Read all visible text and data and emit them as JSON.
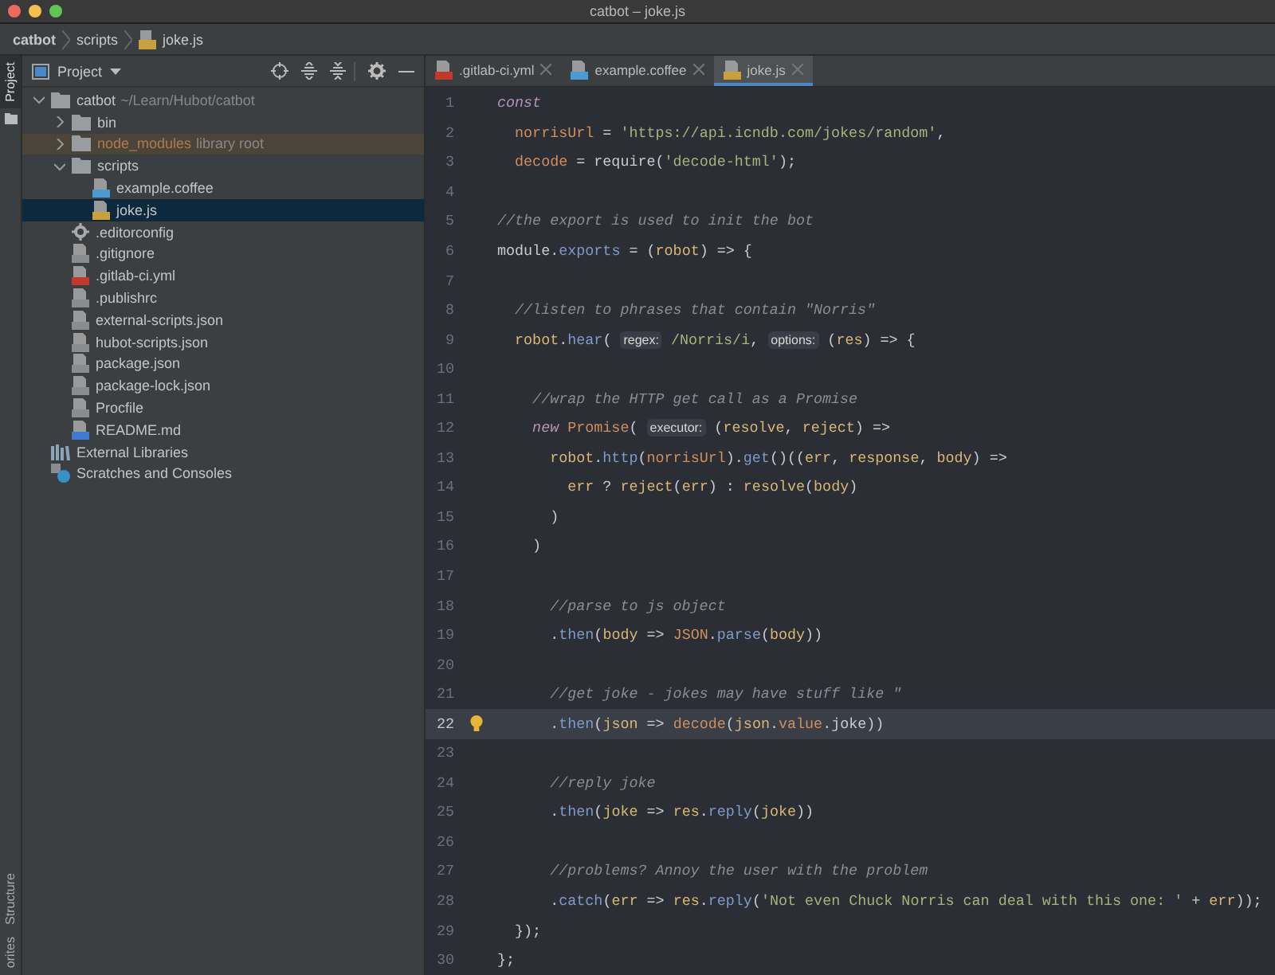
{
  "window": {
    "title": "catbot – joke.js"
  },
  "breadcrumb": [
    {
      "label": "catbot",
      "kind": "project"
    },
    {
      "label": "scripts",
      "kind": "folder"
    },
    {
      "label": "joke.js",
      "kind": "js"
    }
  ],
  "stripe": {
    "top": [
      {
        "label": "Project",
        "selected": true
      }
    ],
    "bottom": [
      {
        "label": "Structure",
        "selected": false
      },
      {
        "label": "orites",
        "selected": false
      }
    ]
  },
  "project_panel": {
    "title": "Project",
    "tree": [
      {
        "name": "catbot",
        "detail": "~/Learn/Hubot/catbot",
        "kind": "folder",
        "expanded": true,
        "selected": false,
        "children": [
          {
            "name": "bin",
            "kind": "folder",
            "expanded": false,
            "selected": false
          },
          {
            "name": "node_modules",
            "detail": "library root",
            "kind": "excluded",
            "expanded": false,
            "selected": false
          },
          {
            "name": "scripts",
            "kind": "folder",
            "expanded": true,
            "selected": false,
            "children": [
              {
                "name": "example.coffee",
                "kind": "coffee",
                "selected": false
              },
              {
                "name": "joke.js",
                "kind": "js",
                "selected": true
              }
            ]
          },
          {
            "name": ".editorconfig",
            "kind": "gear",
            "selected": false
          },
          {
            "name": ".gitignore",
            "kind": "ignore",
            "selected": false
          },
          {
            "name": ".gitlab-ci.yml",
            "kind": "yml",
            "selected": false
          },
          {
            "name": ".publishrc",
            "kind": "file",
            "selected": false
          },
          {
            "name": "external-scripts.json",
            "kind": "json",
            "selected": false
          },
          {
            "name": "hubot-scripts.json",
            "kind": "json",
            "selected": false
          },
          {
            "name": "package.json",
            "kind": "json",
            "selected": false
          },
          {
            "name": "package-lock.json",
            "kind": "json",
            "selected": false
          },
          {
            "name": "Procfile",
            "kind": "file",
            "selected": false
          },
          {
            "name": "README.md",
            "kind": "md",
            "selected": false
          }
        ]
      },
      {
        "name": "External Libraries",
        "kind": "libraries",
        "selected": false
      },
      {
        "name": "Scratches and Consoles",
        "kind": "scratches",
        "selected": false
      }
    ]
  },
  "tabs": [
    {
      "label": ".gitlab-ci.yml",
      "kind": "yml",
      "selected": false
    },
    {
      "label": "example.coffee",
      "kind": "coffee",
      "selected": false
    },
    {
      "label": "joke.js",
      "kind": "js",
      "selected": true
    }
  ],
  "code": [
    {
      "number": "1",
      "current": false,
      "tokens": [
        {
          "kind": "kw",
          "text": "const"
        }
      ]
    },
    {
      "number": "2",
      "current": false,
      "tokens": [
        {
          "kind": "local",
          "text": "  norrisUrl"
        },
        {
          "kind": "plain",
          "text": " = "
        },
        {
          "kind": "str",
          "text": "'https://api.icndb.com/jokes/random'"
        },
        {
          "kind": "plain",
          "text": ","
        }
      ]
    },
    {
      "number": "3",
      "current": false,
      "tokens": [
        {
          "kind": "local",
          "text": "  decode"
        },
        {
          "kind": "plain",
          "text": " = require("
        },
        {
          "kind": "str",
          "text": "'decode-html'"
        },
        {
          "kind": "plain",
          "text": ");"
        }
      ]
    },
    {
      "number": "4",
      "current": false
    },
    {
      "number": "5",
      "current": false,
      "tokens": [
        {
          "kind": "comment",
          "text": "//the export is used to init the bot"
        }
      ]
    },
    {
      "number": "6",
      "current": false,
      "tokens": [
        {
          "kind": "plain",
          "text": "module."
        },
        {
          "kind": "func",
          "text": "exports"
        },
        {
          "kind": "plain",
          "text": " = ("
        },
        {
          "kind": "param",
          "text": "robot"
        },
        {
          "kind": "plain",
          "text": ") => {"
        }
      ]
    },
    {
      "number": "7",
      "current": false
    },
    {
      "number": "8",
      "current": false,
      "tokens": [
        {
          "kind": "comment",
          "text": "  //listen to phrases that contain \"Norris\""
        }
      ]
    },
    {
      "number": "9",
      "current": false,
      "tokens": [
        {
          "kind": "param",
          "text": "  robot"
        },
        {
          "kind": "plain",
          "text": "."
        },
        {
          "kind": "func",
          "text": "hear"
        },
        {
          "kind": "plain",
          "text": "( "
        },
        {
          "kind": "hint",
          "text": "regex:"
        },
        {
          "kind": "str",
          "text": " /Norris/i"
        },
        {
          "kind": "plain",
          "text": ", "
        },
        {
          "kind": "hint",
          "text": "options:"
        },
        {
          "kind": "plain",
          "text": " ("
        },
        {
          "kind": "param",
          "text": "res"
        },
        {
          "kind": "plain",
          "text": ") => {"
        }
      ]
    },
    {
      "number": "10",
      "current": false
    },
    {
      "number": "11",
      "current": false,
      "tokens": [
        {
          "kind": "comment",
          "text": "    //wrap the HTTP get call as a Promise"
        }
      ]
    },
    {
      "number": "12",
      "current": false,
      "tokens": [
        {
          "kind": "kw",
          "text": "    new "
        },
        {
          "kind": "local",
          "text": "Promise"
        },
        {
          "kind": "plain",
          "text": "( "
        },
        {
          "kind": "hint",
          "text": "executor:"
        },
        {
          "kind": "plain",
          "text": " ("
        },
        {
          "kind": "param",
          "text": "resolve"
        },
        {
          "kind": "plain",
          "text": ", "
        },
        {
          "kind": "param",
          "text": "reject"
        },
        {
          "kind": "plain",
          "text": ") =>"
        }
      ]
    },
    {
      "number": "13",
      "current": false,
      "tokens": [
        {
          "kind": "param",
          "text": "      robot"
        },
        {
          "kind": "plain",
          "text": "."
        },
        {
          "kind": "func",
          "text": "http"
        },
        {
          "kind": "plain",
          "text": "("
        },
        {
          "kind": "local",
          "text": "norrisUrl"
        },
        {
          "kind": "plain",
          "text": ")."
        },
        {
          "kind": "func",
          "text": "get"
        },
        {
          "kind": "plain",
          "text": "()(("
        },
        {
          "kind": "param",
          "text": "err"
        },
        {
          "kind": "plain",
          "text": ", "
        },
        {
          "kind": "param",
          "text": "response"
        },
        {
          "kind": "plain",
          "text": ", "
        },
        {
          "kind": "param",
          "text": "body"
        },
        {
          "kind": "plain",
          "text": ") =>"
        }
      ]
    },
    {
      "number": "14",
      "current": false,
      "tokens": [
        {
          "kind": "param",
          "text": "        err"
        },
        {
          "kind": "plain",
          "text": " ? "
        },
        {
          "kind": "param",
          "text": "reject"
        },
        {
          "kind": "plain",
          "text": "("
        },
        {
          "kind": "param",
          "text": "err"
        },
        {
          "kind": "plain",
          "text": ") : "
        },
        {
          "kind": "param",
          "text": "resolve"
        },
        {
          "kind": "plain",
          "text": "("
        },
        {
          "kind": "param",
          "text": "body"
        },
        {
          "kind": "plain",
          "text": ")"
        }
      ]
    },
    {
      "number": "15",
      "current": false,
      "tokens": [
        {
          "kind": "plain",
          "text": "      )"
        }
      ]
    },
    {
      "number": "16",
      "current": false,
      "tokens": [
        {
          "kind": "plain",
          "text": "    )"
        }
      ]
    },
    {
      "number": "17",
      "current": false
    },
    {
      "number": "18",
      "current": false,
      "tokens": [
        {
          "kind": "comment",
          "text": "      //parse to js object"
        }
      ]
    },
    {
      "number": "19",
      "current": false,
      "tokens": [
        {
          "kind": "plain",
          "text": "      ."
        },
        {
          "kind": "func",
          "text": "then"
        },
        {
          "kind": "plain",
          "text": "("
        },
        {
          "kind": "param",
          "text": "body"
        },
        {
          "kind": "plain",
          "text": " => "
        },
        {
          "kind": "local",
          "text": "JSON"
        },
        {
          "kind": "plain",
          "text": "."
        },
        {
          "kind": "func",
          "text": "parse"
        },
        {
          "kind": "plain",
          "text": "("
        },
        {
          "kind": "param",
          "text": "body"
        },
        {
          "kind": "plain",
          "text": "))"
        }
      ]
    },
    {
      "number": "20",
      "current": false
    },
    {
      "number": "21",
      "current": false,
      "tokens": [
        {
          "kind": "comment",
          "text": "      //get joke - jokes may have stuff like \""
        }
      ]
    },
    {
      "number": "22",
      "current": true,
      "tokens": [
        {
          "kind": "plain",
          "text": "      ."
        },
        {
          "kind": "func",
          "text": "then"
        },
        {
          "kind": "plain",
          "text": "("
        },
        {
          "kind": "param",
          "text": "json"
        },
        {
          "kind": "plain",
          "text": " => "
        },
        {
          "kind": "local",
          "text": "decode"
        },
        {
          "kind": "plain",
          "text": "("
        },
        {
          "kind": "param",
          "text": "json"
        },
        {
          "kind": "plain",
          "text": "."
        },
        {
          "kind": "local",
          "text": "value"
        },
        {
          "kind": "plain",
          "text": ".joke))"
        }
      ]
    },
    {
      "number": "23",
      "current": false
    },
    {
      "number": "24",
      "current": false,
      "tokens": [
        {
          "kind": "comment",
          "text": "      //reply joke"
        }
      ]
    },
    {
      "number": "25",
      "current": false,
      "tokens": [
        {
          "kind": "plain",
          "text": "      ."
        },
        {
          "kind": "func",
          "text": "then"
        },
        {
          "kind": "plain",
          "text": "("
        },
        {
          "kind": "param",
          "text": "joke"
        },
        {
          "kind": "plain",
          "text": " => "
        },
        {
          "kind": "param",
          "text": "res"
        },
        {
          "kind": "plain",
          "text": "."
        },
        {
          "kind": "func",
          "text": "reply"
        },
        {
          "kind": "plain",
          "text": "("
        },
        {
          "kind": "param",
          "text": "joke"
        },
        {
          "kind": "plain",
          "text": "))"
        }
      ]
    },
    {
      "number": "26",
      "current": false
    },
    {
      "number": "27",
      "current": false,
      "tokens": [
        {
          "kind": "comment",
          "text": "      //problems? Annoy the user with the problem"
        }
      ]
    },
    {
      "number": "28",
      "current": false,
      "tokens": [
        {
          "kind": "plain",
          "text": "      ."
        },
        {
          "kind": "func",
          "text": "catch"
        },
        {
          "kind": "plain",
          "text": "("
        },
        {
          "kind": "param",
          "text": "err"
        },
        {
          "kind": "plain",
          "text": " => "
        },
        {
          "kind": "param",
          "text": "res"
        },
        {
          "kind": "plain",
          "text": "."
        },
        {
          "kind": "func",
          "text": "reply"
        },
        {
          "kind": "plain",
          "text": "("
        },
        {
          "kind": "str",
          "text": "'Not even Chuck Norris can deal with this one: '"
        },
        {
          "kind": "plain",
          "text": " + "
        },
        {
          "kind": "param",
          "text": "err"
        },
        {
          "kind": "plain",
          "text": "));"
        }
      ]
    },
    {
      "number": "29",
      "current": false,
      "tokens": [
        {
          "kind": "plain",
          "text": "  });"
        }
      ]
    },
    {
      "number": "30",
      "current": false,
      "tokens": [
        {
          "kind": "plain",
          "text": "};"
        }
      ]
    }
  ]
}
